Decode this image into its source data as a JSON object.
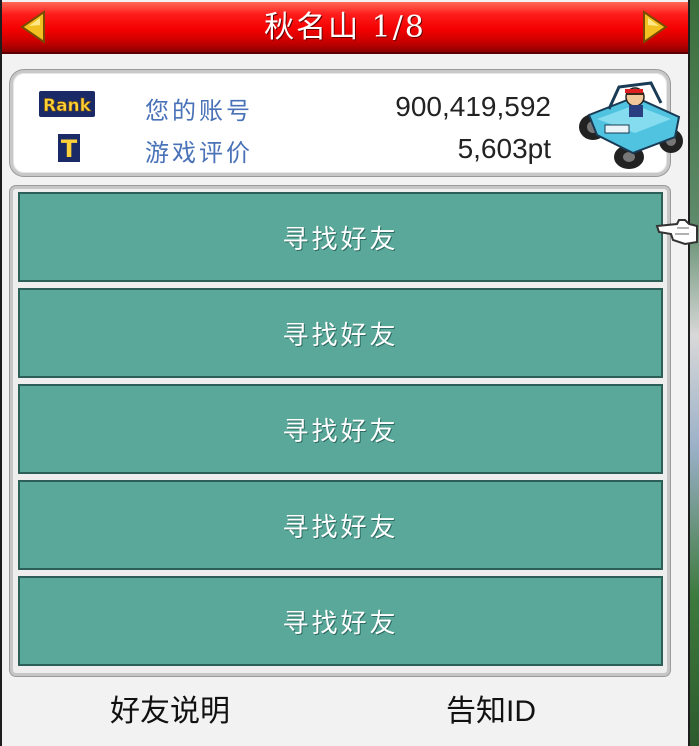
{
  "header": {
    "title": "秋名山 1/8",
    "prev_icon": "triangle-left-icon",
    "next_icon": "triangle-right-icon"
  },
  "player": {
    "rank_logo_text": "Rank",
    "rank_tier": "T",
    "account_label": "您的账号",
    "account_value": "900,419,592",
    "rating_label": "游戏评价",
    "rating_value": "5,603pt",
    "avatar_icon": "buggy-car-icon"
  },
  "friends": {
    "slots": [
      {
        "label": "寻找好友"
      },
      {
        "label": "寻找好友"
      },
      {
        "label": "寻找好友"
      },
      {
        "label": "寻找好友"
      },
      {
        "label": "寻找好友"
      }
    ]
  },
  "footer": {
    "help_label": "好友说明",
    "notify_label_cjk": "告知",
    "notify_label_id": "ID"
  },
  "colors": {
    "header_red": "#f30000",
    "slot_teal": "#5aa899",
    "label_blue": "#4a72b8",
    "arrow_gold": "#f2c020"
  }
}
